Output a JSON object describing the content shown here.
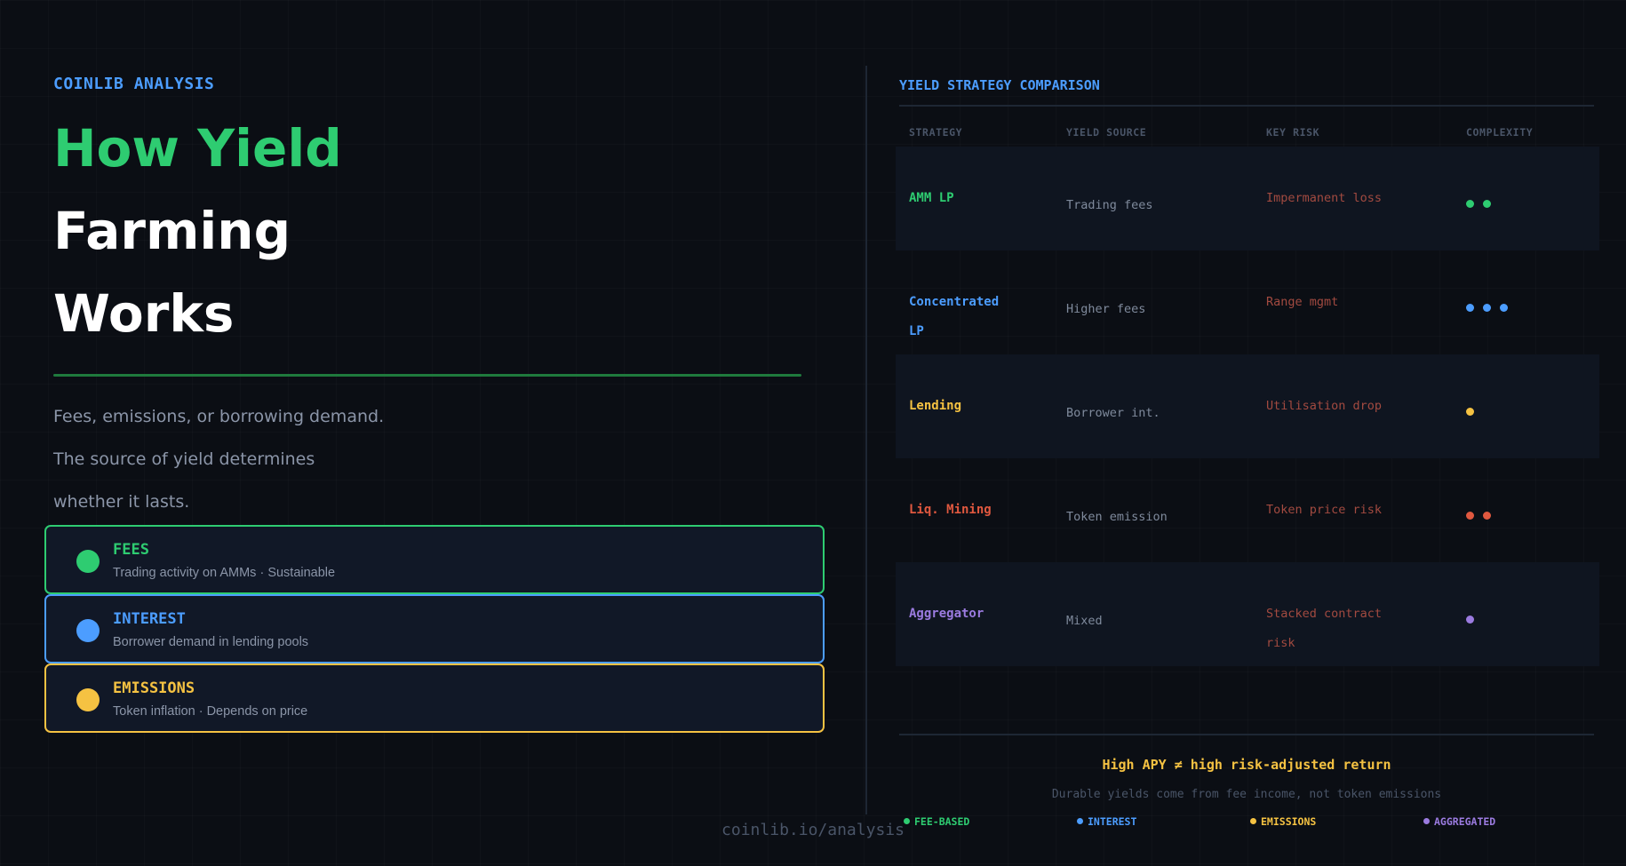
{
  "brand": "COINLIB ANALYSIS",
  "title": {
    "line1": "How Yield",
    "line2": "Farming",
    "line3": "Works"
  },
  "subtitle": {
    "line1": "Fees, emissions, or borrowing demand.",
    "line2": "The source of yield determines",
    "line3": "whether it lasts."
  },
  "sources": [
    {
      "title": "FEES",
      "subtitle": "Trading activity on AMMs · Sustainable",
      "color": "#2ecc71"
    },
    {
      "title": "INTEREST",
      "subtitle": "Borrower demand in lending pools",
      "color": "#4c9dff"
    },
    {
      "title": "EMISSIONS",
      "subtitle": "Token inflation · Depends on price",
      "color": "#f5c242"
    }
  ],
  "comparison": {
    "title": "YIELD STRATEGY COMPARISON",
    "headers": [
      "STRATEGY",
      "YIELD SOURCE",
      "KEY RISK",
      "COMPLEXITY"
    ],
    "rows": [
      {
        "strategy": "AMM LP",
        "source": "Trading fees",
        "risk": "Impermanent loss",
        "complexity": 2,
        "color": "#2ecc71"
      },
      {
        "strategy": "Concentrated LP",
        "source": "Higher fees",
        "risk": "Range mgmt",
        "complexity": 3,
        "color": "#4c9dff"
      },
      {
        "strategy": "Lending",
        "source": "Borrower int.",
        "risk": "Utilisation drop",
        "complexity": 1,
        "color": "#f5c242"
      },
      {
        "strategy": "Liq. Mining",
        "source": "Token emission",
        "risk": "Token price risk",
        "complexity": 2,
        "color": "#e0583f"
      },
      {
        "strategy": "Aggregator",
        "source": "Mixed",
        "risk": "Stacked contract risk",
        "complexity": 1,
        "color": "#9b7be0"
      }
    ],
    "note_headline": "High APY ≠ high risk-adjusted return",
    "note_sub": "Durable yields come from fee income, not token emissions",
    "legend": [
      {
        "label": "FEE-BASED",
        "color": "#2ecc71"
      },
      {
        "label": "INTEREST",
        "color": "#4c9dff"
      },
      {
        "label": "EMISSIONS",
        "color": "#f5c242"
      },
      {
        "label": "AGGREGATED",
        "color": "#9b7be0"
      }
    ]
  },
  "footer": "coinlib.io/analysis"
}
